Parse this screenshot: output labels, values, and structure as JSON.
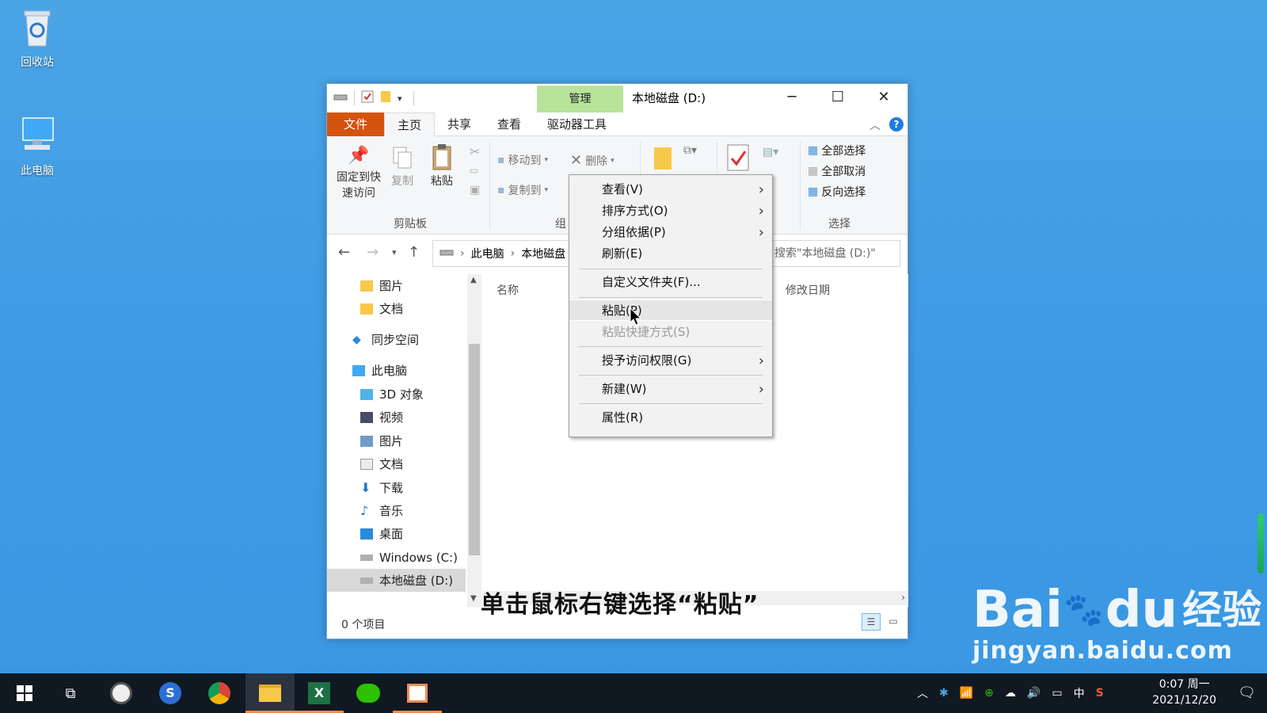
{
  "desktop": {
    "icons": [
      {
        "label": "回收站",
        "icon": "recycle-bin-icon"
      },
      {
        "label": "此电脑",
        "icon": "computer-icon"
      }
    ]
  },
  "window": {
    "title": "本地磁盘 (D:)",
    "manage_tab": "管理",
    "tabs": {
      "file": "文件",
      "home": "主页",
      "share": "共享",
      "view": "查看",
      "drive_tools": "驱动器工具"
    },
    "ribbon": {
      "pin_quick_access": "固定到快\n速访问",
      "copy": "复制",
      "paste": "粘贴",
      "clipboard_group": "剪贴板",
      "move_to": "移动到",
      "copy_to": "复制到",
      "delete": "删除",
      "organize_group": "组",
      "select_all": "全部选择",
      "select_none": "全部取消",
      "invert_selection": "反向选择",
      "select_group": "选择"
    },
    "address": {
      "crumbs": [
        "此电脑",
        "本地磁盘"
      ],
      "search_placeholder": "搜索\"本地磁盘 (D:)\""
    },
    "nav_items": [
      {
        "label": "图片",
        "icon": "folder-icon"
      },
      {
        "label": "文档",
        "icon": "folder-icon"
      },
      {
        "label": "同步空间",
        "icon": "sync-space-icon"
      },
      {
        "label": "此电脑",
        "icon": "computer-icon"
      },
      {
        "label": "3D 对象",
        "icon": "cube-icon"
      },
      {
        "label": "视频",
        "icon": "video-icon"
      },
      {
        "label": "图片",
        "icon": "pictures-icon"
      },
      {
        "label": "文档",
        "icon": "document-icon"
      },
      {
        "label": "下载",
        "icon": "download-icon"
      },
      {
        "label": "音乐",
        "icon": "music-icon"
      },
      {
        "label": "桌面",
        "icon": "desktop-icon"
      },
      {
        "label": "Windows (C:)",
        "icon": "drive-icon"
      },
      {
        "label": "本地磁盘 (D:)",
        "icon": "drive-icon"
      }
    ],
    "columns": {
      "name": "名称",
      "modified": "修改日期"
    },
    "status": "0 个项目"
  },
  "context_menu": {
    "items": [
      {
        "label": "查看(V)",
        "submenu": true
      },
      {
        "label": "排序方式(O)",
        "submenu": true
      },
      {
        "label": "分组依据(P)",
        "submenu": true
      },
      {
        "label": "刷新(E)",
        "submenu": false
      },
      {
        "label": "自定义文件夹(F)...",
        "submenu": false
      },
      {
        "label": "粘贴(P)",
        "submenu": false
      },
      {
        "label": "粘贴快捷方式(S)",
        "submenu": false,
        "disabled": true
      },
      {
        "label": "授予访问权限(G)",
        "submenu": true
      },
      {
        "label": "新建(W)",
        "submenu": true
      },
      {
        "label": "属性(R)",
        "submenu": false
      }
    ]
  },
  "caption": "单击鼠标右键选择“粘贴”",
  "watermark": {
    "brand": "Bai",
    "brand2": "du",
    "product": "经验",
    "url": "jingyan.baidu.com"
  },
  "taskbar": {
    "clock_time": "0:07 周一",
    "clock_date": "2021/12/20",
    "ime": "中"
  },
  "colors": {
    "file_tab": "#d4530f",
    "manage_tab": "#b8e39b",
    "desktop": "#3f9be4",
    "taskbar": "#101822"
  }
}
